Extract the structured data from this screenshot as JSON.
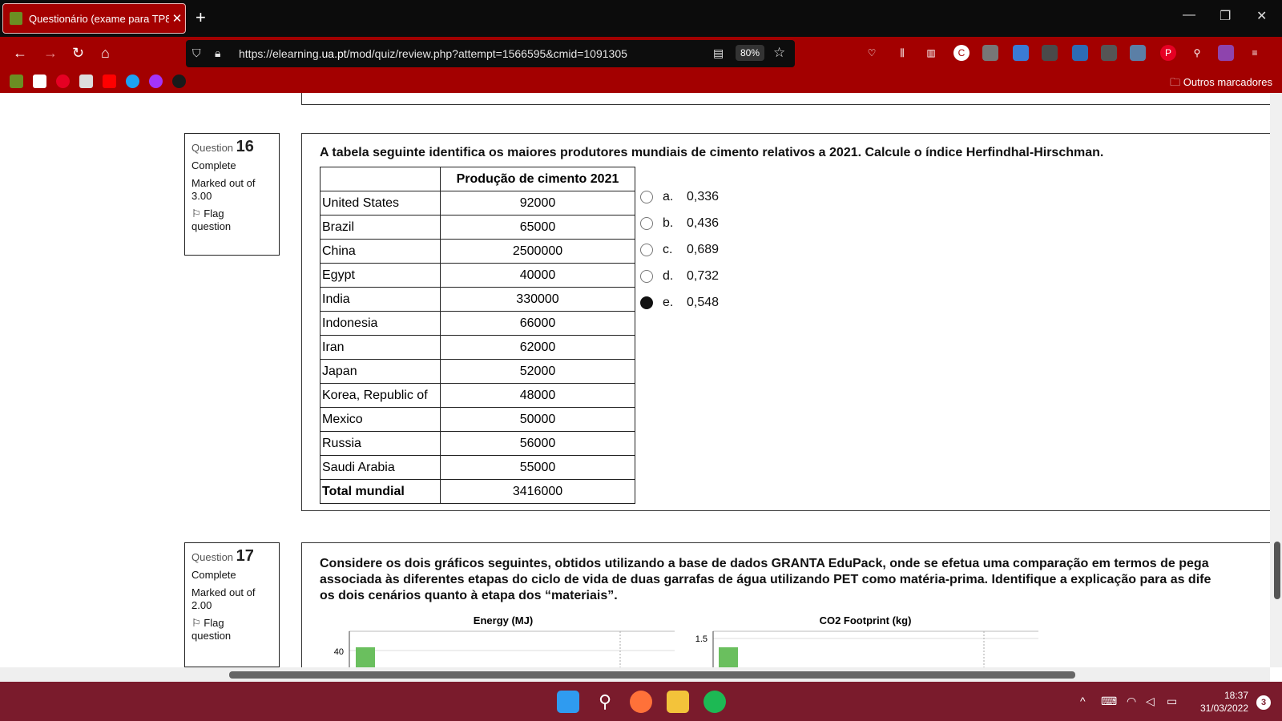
{
  "browser": {
    "tab_title": "Questionário (exame para TP8-",
    "tab_close": "✕",
    "new_tab": "+",
    "url_prefix": "https://elearning.",
    "url_domain": "ua.pt",
    "url_rest": "/mod/quiz/review.php?attempt=1566595&cmid=1091305",
    "zoom": "80%",
    "bookmarks_folder": "Outros marcadores"
  },
  "q16": {
    "label": "Question",
    "number": "16",
    "status": "Complete",
    "marked_line1": "Marked out of",
    "marked_line2": "3.00",
    "flag_line1": "Flag",
    "flag_line2": "question",
    "text": "A tabela seguinte identifica os maiores produtores mundiais de cimento relativos a 2021. Calcule o índice Herfindhal-Hirschman.",
    "table_header": "Produção de cimento 2021",
    "rows": [
      {
        "country": "United States",
        "value": "92000"
      },
      {
        "country": "Brazil",
        "value": "65000"
      },
      {
        "country": "China",
        "value": "2500000"
      },
      {
        "country": "Egypt",
        "value": "40000"
      },
      {
        "country": "India",
        "value": "330000"
      },
      {
        "country": "Indonesia",
        "value": "66000"
      },
      {
        "country": "Iran",
        "value": "62000"
      },
      {
        "country": "Japan",
        "value": "52000"
      },
      {
        "country": "Korea, Republic of",
        "value": "48000"
      },
      {
        "country": "Mexico",
        "value": "50000"
      },
      {
        "country": "Russia",
        "value": "56000"
      },
      {
        "country": "Saudi Arabia",
        "value": "55000"
      }
    ],
    "total_label": "Total mundial",
    "total_value": "3416000",
    "answers": [
      {
        "letter": "a.",
        "value": "0,336",
        "selected": false
      },
      {
        "letter": "b.",
        "value": "0,436",
        "selected": false
      },
      {
        "letter": "c.",
        "value": "0,689",
        "selected": false
      },
      {
        "letter": "d.",
        "value": "0,732",
        "selected": false
      },
      {
        "letter": "e.",
        "value": "0,548",
        "selected": true
      }
    ]
  },
  "q17": {
    "label": "Question",
    "number": "17",
    "status": "Complete",
    "marked_line1": "Marked out of",
    "marked_line2": "2.00",
    "flag_line1": "Flag",
    "flag_line2": "question",
    "text_line1": "Considere os dois gráficos seguintes, obtidos utilizando a base de dados GRANTA EduPack, onde se efetua uma comparação em termos de pega",
    "text_line2": "associada às diferentes etapas do ciclo de vida de duas garrafas de água utilizando PET como matéria-prima. Identifique a explicação para as dife",
    "text_line3": "os dois cenários quanto à etapa dos “materiais”.",
    "chart1_title": "Energy (MJ)",
    "chart1_tick": "40",
    "chart2_title": "CO2 Footprint (kg)",
    "chart2_tick": "1.5",
    "bar_color": "#6abf5e"
  },
  "taskbar": {
    "time": "18:37",
    "date": "31/03/2022",
    "notifications": "3"
  }
}
